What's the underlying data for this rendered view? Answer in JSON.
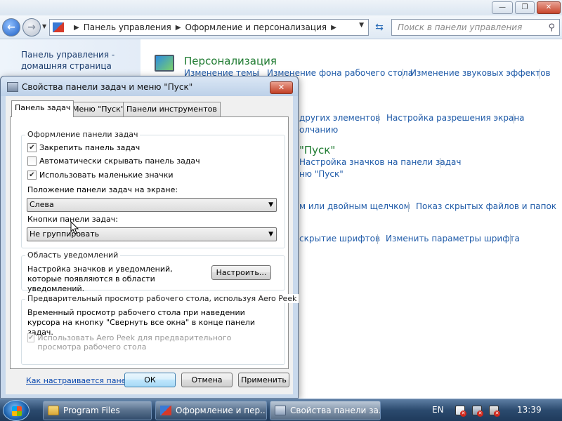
{
  "control_panel": {
    "address": {
      "segment1": "Панель управления",
      "segment2": "Оформление и персонализация"
    },
    "search_placeholder": "Поиск в панели управления",
    "home_link": "Панель управления - домашняя страница",
    "personalization": {
      "title": "Персонализация",
      "links": [
        "Изменение темы",
        "Изменение фона рабочего стола",
        "Изменение звуковых эффектов"
      ]
    },
    "display_links": [
      "других элементов",
      "Настройка разрешения экрана",
      "олчанию"
    ],
    "start_title": "\"Пуск\"",
    "start_links": [
      "Настройка значков на панели задач",
      "ню \"Пуск\""
    ],
    "folder_links": [
      "м или двойным щелчком",
      "Показ скрытых файлов и папок"
    ],
    "font_links": [
      "скрытие шрифтов",
      "Изменить параметры шрифта"
    ]
  },
  "dialog": {
    "title": "Свойства панели задач и меню \"Пуск\"",
    "tabs": [
      "Панель задач",
      "Меню \"Пуск\"",
      "Панели инструментов"
    ],
    "appearance_group": {
      "label": "Оформление панели задач",
      "lock_taskbar": "Закрепить панель задач",
      "autohide": "Автоматически скрывать панель задач",
      "small_icons": "Использовать маленькие значки",
      "location_label": "Положение панели задач на экране:",
      "location_value": "Слева",
      "buttons_label": "Кнопки панели задач:",
      "buttons_value": "Не группировать"
    },
    "notification_group": {
      "label": "Область уведомлений",
      "text": "Настройка значков и уведомлений, которые появляются в области уведомлений.",
      "customize_button": "Настроить..."
    },
    "peek_group": {
      "label": "Предварительный просмотр рабочего стола, используя Aero Peek",
      "text": "Временный просмотр рабочего стола при наведении курсора на кнопку \"Свернуть все окна\" в конце панели задач.",
      "checkbox": "Использовать Aero Peek для предварительного просмотра рабочего стола"
    },
    "help_link": "Как настраивается панель задач?",
    "buttons": {
      "ok": "ОК",
      "cancel": "Отмена",
      "apply": "Применить"
    }
  },
  "taskbar": {
    "items": [
      "Program Files",
      "Оформление и пер...",
      "Свойства панели за..."
    ],
    "language": "EN",
    "clock": "13:39"
  }
}
